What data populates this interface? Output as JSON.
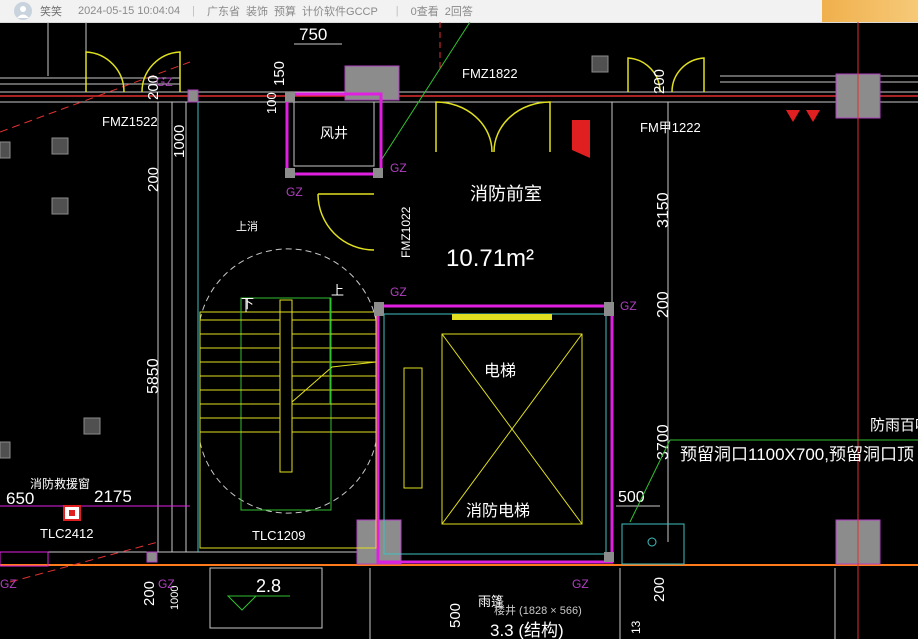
{
  "post_header": {
    "username": "笑笑",
    "timestamp": "2024-05-15 10:04:04",
    "tags": [
      "广东省",
      "装饰",
      "预算",
      "计价软件GCCP"
    ],
    "views": "0查看",
    "replies": "2回答"
  },
  "image_caption": "楼井 (1828 × 566)",
  "drawing": {
    "dims": {
      "d750": "750",
      "d150": "150",
      "d100": "100",
      "d200a": "200",
      "d1000": "1000",
      "d200b": "200",
      "d5850": "5850",
      "d650": "650",
      "d2175": "2175",
      "d3150": "3150",
      "d200c": "200",
      "d3700": "3700",
      "d500": "500",
      "d200d": "200",
      "d200e": "200",
      "d1000b": "1000",
      "d200f": "200",
      "d500b": "500",
      "d13": "13"
    },
    "labels": {
      "fmz1822": "FMZ1822",
      "fmz1522": "FMZ1522",
      "fmj1222": "FM甲1222",
      "fmz1022": "FMZ1022",
      "fengjing": "风井",
      "xiaofang_qianshi": "消防前室",
      "area": "10.71m²",
      "dianti": "电梯",
      "xiaofang_dianti": "消防电梯",
      "xia": "下",
      "shang": "上",
      "tlc1209": "TLC1209",
      "tlc2412": "TLC2412",
      "xiaofang_jiuyuan": "消防救援窗",
      "yuliu": "预留洞口1100X700,预留洞口顶",
      "fangyu": "防雨百叶",
      "yupeng": "雨篷",
      "level": "2.8",
      "bottom_text": "3.3 (结构)",
      "gz1": "GZ",
      "gz2": "GZ",
      "gz3": "GZ",
      "gz4": "GZ",
      "gz5": "GZ",
      "gz6": "GZ",
      "gz7": "GZ",
      "gz8": "GZ",
      "shangxiao": "上消"
    }
  }
}
